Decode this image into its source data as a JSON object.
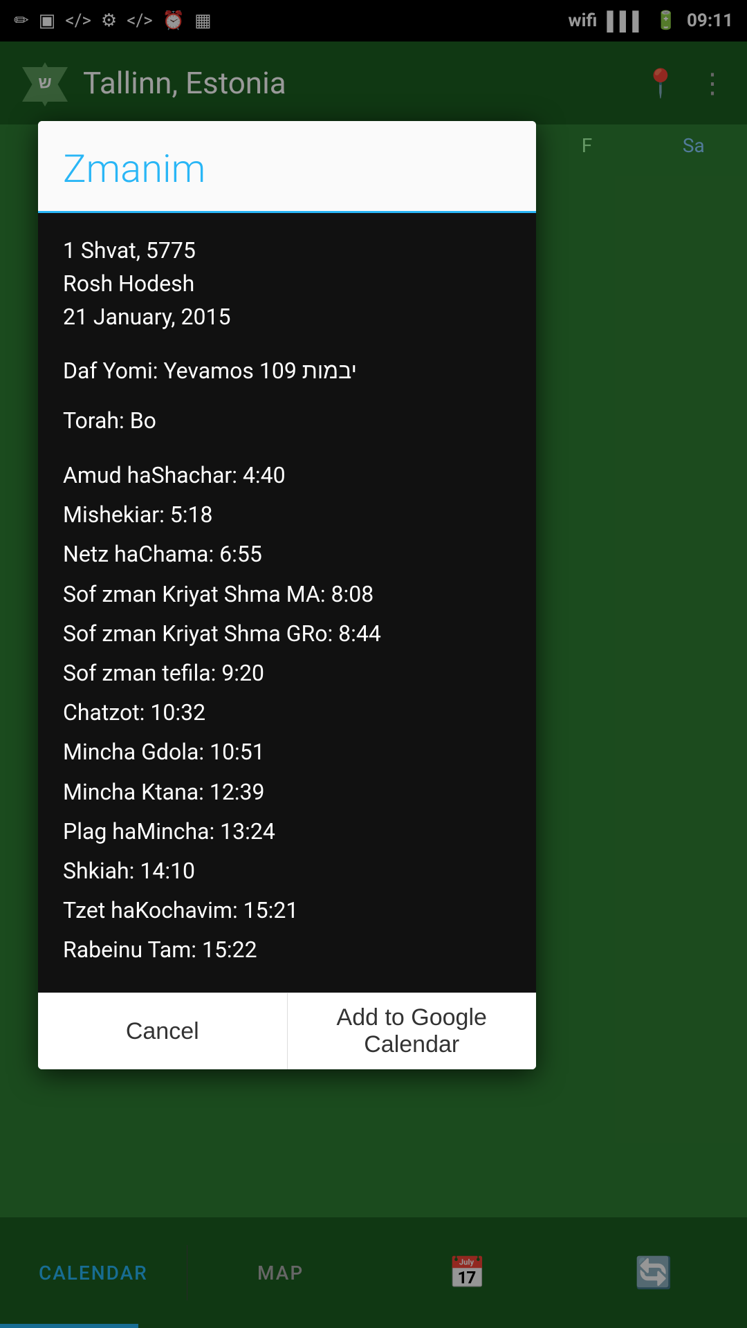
{
  "statusBar": {
    "time": "09:11",
    "icons_left": [
      "pencil-icon",
      "image-icon",
      "code-icon",
      "usb-icon",
      "code2-icon",
      "clock-icon",
      "barcode-icon"
    ],
    "icons_right": [
      "wifi-icon",
      "signal-icon",
      "battery-icon"
    ]
  },
  "header": {
    "appName": "Tallinn, Estonia",
    "logoLetter": "ש"
  },
  "dialog": {
    "title": "Zmanim",
    "date": {
      "hebrewDate": "1 Shvat, 5775",
      "specialDay": "Rosh Hodesh",
      "gregorianDate": "21 January, 2015"
    },
    "dafYomi": "Daf Yomi: Yevamos 109 יבמות",
    "torah": "Torah: Bo",
    "times": [
      "Amud haShachar: 4:40",
      "Mishekiar: 5:18",
      "Netz haChama: 6:55",
      "Sof zman Kriyat Shma MA: 8:08",
      "Sof zman Kriyat Shma GRo: 8:44",
      "Sof zman tefila: 9:20",
      "Chatzot: 10:32",
      "Mincha Gdola: 10:51",
      "Mincha Ktana: 12:39",
      "Plag haMincha: 13:24",
      "Shkiah: 14:10",
      "Tzet haKochavim: 15:21",
      "Rabeinu Tam: 15:22"
    ],
    "buttons": {
      "cancel": "Cancel",
      "addToCalendar": "Add to Google Calendar"
    }
  },
  "bottomNav": {
    "items": [
      {
        "label": "CALENDAR",
        "active": true
      },
      {
        "label": "MAP",
        "active": false
      }
    ]
  }
}
